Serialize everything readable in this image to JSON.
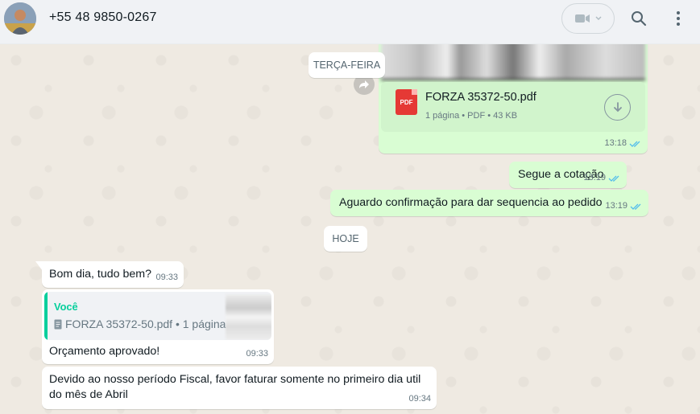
{
  "header": {
    "contact_name": "+55 48 9850-0267"
  },
  "dates": {
    "tuesday": "TERÇA-FEIRA",
    "today": "HOJE"
  },
  "messages": {
    "doc": {
      "file_name": "FORZA 35372-50.pdf",
      "file_info": "1 página • PDF • 43 KB",
      "icon_label": "PDF",
      "time": "13:18"
    },
    "segue": {
      "text": "Segue a cotação",
      "time": "13:19"
    },
    "aguardo": {
      "text": "Aguardo confirmação para dar sequencia ao pedido",
      "time": "13:19"
    },
    "bom_dia": {
      "text": "Bom dia, tudo bem?",
      "time": "09:33"
    },
    "reply": {
      "quote_author": "Você",
      "quote_doc": "FORZA 35372-50.pdf • 1 página",
      "text": "Orçamento aprovado!",
      "time": "09:33"
    },
    "fiscal": {
      "text": "Devido ao nosso período Fiscal, favor faturar somente no primeiro dia util do mês de Abril",
      "time": "09:34"
    }
  },
  "icons": {
    "video": "video-camera-icon",
    "search": "search-icon",
    "menu": "kebab-menu-icon",
    "read": "double-check-icon",
    "download": "download-icon",
    "forward": "forward-icon"
  },
  "colors": {
    "outgoing_bubble": "#d9fdd3",
    "incoming_bubble": "#ffffff",
    "read_ticks": "#53bdeb",
    "quote_accent": "#06cf9c",
    "pdf_red": "#e53935"
  }
}
